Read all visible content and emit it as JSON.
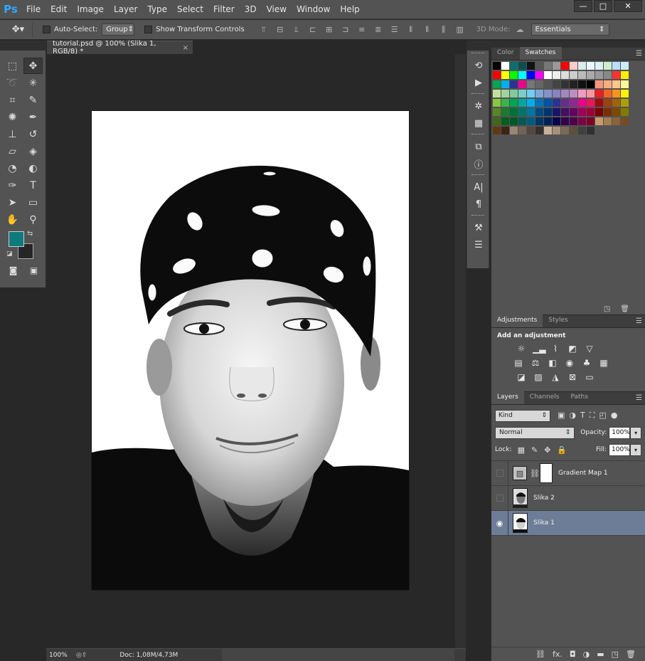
{
  "app": {
    "logo": "Ps"
  },
  "menu": [
    "File",
    "Edit",
    "Image",
    "Layer",
    "Type",
    "Select",
    "Filter",
    "3D",
    "View",
    "Window",
    "Help"
  ],
  "window_controls": {
    "minimize": "—",
    "maximize": "□",
    "close": "✕"
  },
  "options": {
    "auto_select_label": "Auto-Select:",
    "auto_select_value": "Group",
    "transform_label": "Show Transform Controls",
    "mode_3d_label": "3D Mode:",
    "workspace": "Essentials"
  },
  "document": {
    "tab_title": "tutorial.psd @ 100% (Slika 1, RGB/8) *",
    "zoom": "100%",
    "doc_size": "Doc: 1,08M/4,73M"
  },
  "colors": {
    "foreground": "#0f7a7e",
    "background": "#262626"
  },
  "color_panel": {
    "tabs": [
      "Color",
      "Swatches"
    ],
    "active_tab": "Swatches"
  },
  "adjustments": {
    "tabs": [
      "Adjustments",
      "Styles"
    ],
    "title": "Add an adjustment"
  },
  "layers_panel": {
    "tabs": [
      "Layers",
      "Channels",
      "Paths"
    ],
    "kind": "Kind",
    "blend_mode": "Normal",
    "opacity_label": "Opacity:",
    "opacity": "100%",
    "lock_label": "Lock:",
    "fill_label": "Fill:",
    "fill": "100%",
    "layers": [
      {
        "name": "Gradient Map 1",
        "visible": false,
        "selected": false,
        "type": "adjustment"
      },
      {
        "name": "Slika 2",
        "visible": false,
        "selected": false,
        "type": "image"
      },
      {
        "name": "Slika 1",
        "visible": true,
        "selected": true,
        "type": "image"
      }
    ]
  },
  "swatches": [
    [
      "#000000",
      "#ffffff",
      "#0e6e6e",
      "#0d4f4f",
      "#111111",
      "#555555",
      "#777777",
      "#999999",
      "#ff0000",
      "#ffcccc",
      "#d8eeee",
      "#eaf6ff",
      "#ddeeff",
      "#cceecc",
      "#bbddff",
      "#cceeff"
    ],
    [
      "#ff0000",
      "#ffff00",
      "#00ff00",
      "#00ffff",
      "#0000ff",
      "#ff00ff",
      "#ffffff",
      "#eeeeee",
      "#dddddd",
      "#cccccc",
      "#bbbbbb",
      "#aaaaaa",
      "#999999",
      "#888888",
      "#ff3333",
      "#ffee00"
    ],
    [
      "#00a651",
      "#00aeef",
      "#2e3192",
      "#ec008c",
      "#777777",
      "#666666",
      "#555555",
      "#444444",
      "#333333",
      "#222222",
      "#111111",
      "#000000",
      "#f7977a",
      "#f9ad81",
      "#fdc68a",
      "#fff79a"
    ],
    [
      "#c4df9b",
      "#a3d39c",
      "#82ca9d",
      "#7bcdc8",
      "#6ecff6",
      "#7ea7d8",
      "#8493ca",
      "#8882be",
      "#a187be",
      "#bc8dbf",
      "#f49ac2",
      "#f6989d",
      "#ed1c24",
      "#f26522",
      "#f7941d",
      "#fff200"
    ],
    [
      "#8dc63f",
      "#39b54a",
      "#00a651",
      "#00a99d",
      "#00aeef",
      "#0072bc",
      "#0054a6",
      "#2e3192",
      "#662d91",
      "#92278f",
      "#ec008c",
      "#ed145b",
      "#9e0b0f",
      "#a0410d",
      "#a36209",
      "#aba000"
    ],
    [
      "#598527",
      "#197b30",
      "#007236",
      "#00746b",
      "#0076a3",
      "#004a80",
      "#003471",
      "#1b1464",
      "#440e62",
      "#630460",
      "#9e005d",
      "#9e0039",
      "#790000",
      "#7b2e00",
      "#7d4900",
      "#827b00"
    ],
    [
      "#406618",
      "#005e20",
      "#005826",
      "#005952",
      "#005b7f",
      "#003663",
      "#002157",
      "#0d004c",
      "#32004b",
      "#4b0049",
      "#7b0046",
      "#7a0026",
      "#c69c6d",
      "#a67c52",
      "#8c6239",
      "#754c24"
    ],
    [
      "#603913",
      "#3c2415",
      "#998675",
      "#736357",
      "#534741",
      "#362f2d",
      "#c7b299",
      "#a8917a",
      "#7a6a56",
      "#5c4f3e",
      "#404040",
      "#303030"
    ]
  ]
}
